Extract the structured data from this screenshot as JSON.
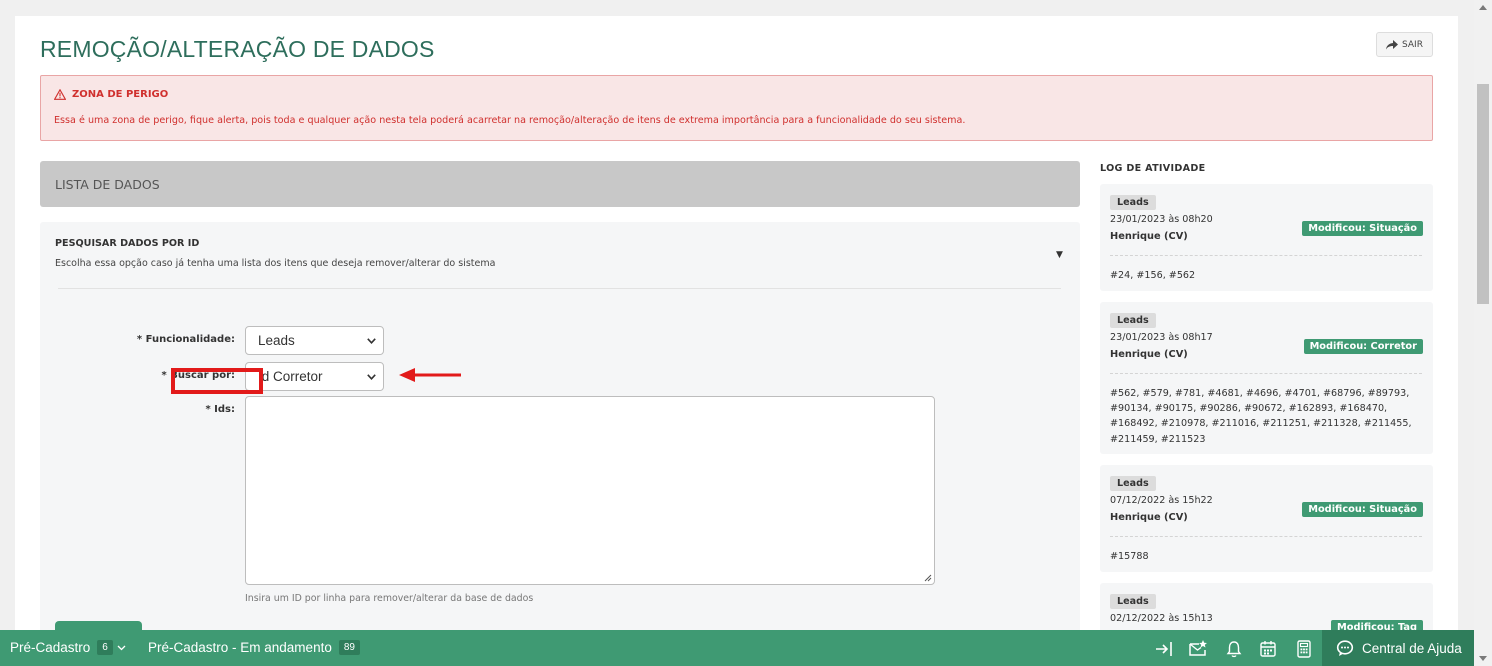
{
  "page": {
    "title": "REMOÇÃO/ALTERAÇÃO DE DADOS",
    "exit_label": "SAIR"
  },
  "danger": {
    "title": "ZONA DE PERIGO",
    "text": "Essa é uma zona de perigo, fique alerta, pois toda e qualquer ação nesta tela poderá acarretar na remoção/alteração de itens de extrema importância para a funcionalidade do seu sistema."
  },
  "list": {
    "header": "LISTA DE DADOS"
  },
  "search": {
    "title": "PESQUISAR DADOS POR ID",
    "description": "Escolha essa opção caso já tenha uma lista dos itens que deseja remover/alterar do sistema",
    "fields": {
      "funcionalidade_label": "* Funcionalidade:",
      "funcionalidade_value": "Leads",
      "buscar_label": "* Buscar por:",
      "buscar_value": "Id Corretor",
      "ids_label": "* Ids:",
      "ids_hint": "Insira um ID por linha para remover/alterar da base de dados"
    }
  },
  "log": {
    "title": "LOG DE ATIVIDADE",
    "entries": [
      {
        "tag": "Leads",
        "date": "23/01/2023 às 08h20",
        "user": "Henrique (CV)",
        "action": "Modificou: Situação",
        "ids": "#24, #156, #562"
      },
      {
        "tag": "Leads",
        "date": "23/01/2023 às 08h17",
        "user": "Henrique (CV)",
        "action": "Modificou: Corretor",
        "ids": "#562, #579, #781, #4681, #4696, #4701, #68796, #89793, #90134, #90175, #90286, #90672, #162893, #168470, #168492, #210978, #211016, #211251, #211328, #211455, #211459, #211523"
      },
      {
        "tag": "Leads",
        "date": "07/12/2022 às 15h22",
        "user": "Henrique (CV)",
        "action": "Modificou: Situação",
        "ids": "#15788"
      },
      {
        "tag": "Leads",
        "date": "02/12/2022 às 15h13",
        "user": "",
        "action": "Modificou: Tag",
        "ids": ""
      }
    ]
  },
  "bottom_bar": {
    "item1_label": "Pré-Cadastro",
    "item1_count": "6",
    "item2_label": "Pré-Cadastro - Em andamento",
    "item2_count": "89",
    "help_label": "Central de Ajuda"
  },
  "colors": {
    "brand_green": "#3f9a73",
    "title_green": "#2e6e5c",
    "danger_red": "#d0302e",
    "highlight_red": "#e21a1a"
  }
}
